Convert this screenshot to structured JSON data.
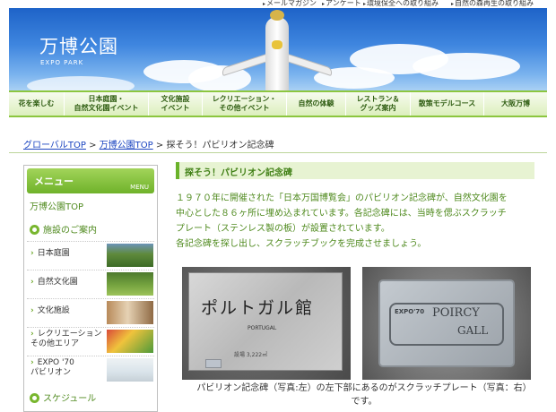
{
  "top_links": [
    "メールマガジン",
    "アンケート",
    "環境保全への取り組み",
    "自然の森再生の取り組み"
  ],
  "header": {
    "title": "万博公園",
    "subtitle": "EXPO PARK"
  },
  "global_nav": [
    "花を楽しむ",
    "日本庭園・\n自然文化園イベント",
    "文化施設\nイベント",
    "レクリエーション・\nその他イベント",
    "自然の体験",
    "レストラン＆\nグッズ案内",
    "散策モデルコース",
    "大阪万博"
  ],
  "breadcrumb": {
    "item1": "グローバルTOP",
    "sep": ">",
    "item2": "万博公園TOP",
    "current": "探そう！パビリオン記念碑"
  },
  "sidebar": {
    "menu_title": "メニュー",
    "menu_sub": "MENU",
    "top_link": "万博公園TOP",
    "section_facilities": "施設のご案内",
    "items": [
      "日本庭園",
      "自然文化園",
      "文化施設",
      "レクリエーション\nその他エリア",
      "EXPO '70\nパビリオン"
    ],
    "section_schedule": "スケジュール"
  },
  "main": {
    "section_title": "探そう！パビリオン記念碑",
    "intro_lines": [
      "１９７０年に開催された「日本万国博覧会」のパビリオン記念碑が、自然文化園を",
      "中心とした８６ヶ所に埋め込まれています。各記念碑には、当時を偲ぶスクラッチ",
      "プレート（ステンレス製の板）が設置されています。",
      "各記念碑を探し出し、スクラッチブックを完成させましょう。"
    ],
    "photo_left": {
      "text_jp": "ポルトガル館",
      "text_en": "PORTUGAL",
      "text_small": "設場 3,222㎡"
    },
    "photo_right": {
      "text_a": "EXPO'70",
      "text_b": "POIRCY",
      "text_c": "GALL"
    },
    "caption_lines": [
      "パビリオン記念碑（写真:左）の左下部にあるのがスクラッチプレート（写真：右）",
      "です。"
    ]
  },
  "colors": {
    "accent_green": "#6ab22a",
    "link_blue": "#1a44c0",
    "text_green": "#4f8a1e"
  }
}
